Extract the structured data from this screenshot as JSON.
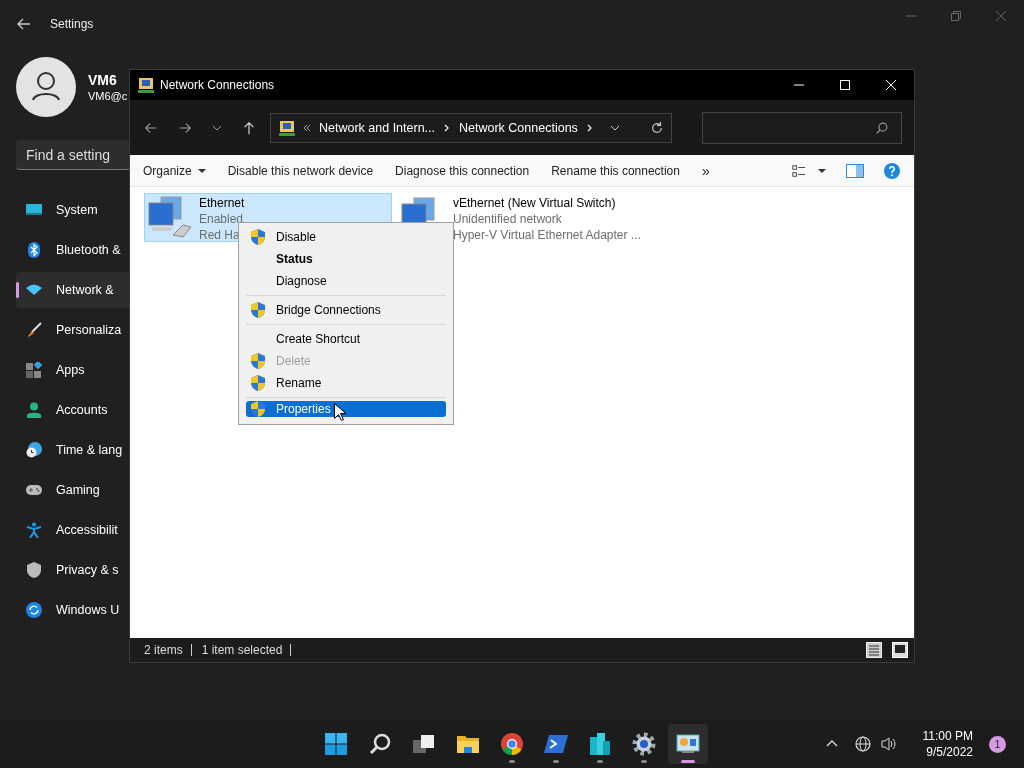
{
  "settings": {
    "title": "Settings",
    "user": {
      "name": "VM6",
      "email": "VM6@c"
    },
    "search": {
      "placeholder": "Find a setting"
    },
    "nav": [
      {
        "kind": "system",
        "label": "System",
        "selected": false
      },
      {
        "kind": "bluetooth",
        "label": "Bluetooth &",
        "selected": false
      },
      {
        "kind": "network",
        "label": "Network &",
        "selected": true
      },
      {
        "kind": "personalize",
        "label": "Personaliza",
        "selected": false
      },
      {
        "kind": "apps",
        "label": "Apps",
        "selected": false
      },
      {
        "kind": "accounts",
        "label": "Accounts",
        "selected": false
      },
      {
        "kind": "time",
        "label": "Time & lang",
        "selected": false
      },
      {
        "kind": "gaming",
        "label": "Gaming",
        "selected": false
      },
      {
        "kind": "accessibility",
        "label": "Accessibilit",
        "selected": false
      },
      {
        "kind": "privacy",
        "label": "Privacy & s",
        "selected": false
      },
      {
        "kind": "update",
        "label": "Windows U",
        "selected": false
      }
    ]
  },
  "explorer": {
    "title": "Network Connections",
    "breadcrumb": [
      "Network and Intern...",
      "Network Connections"
    ],
    "commands": [
      {
        "label": "Organize",
        "dropdown": true
      },
      {
        "label": "Disable this network device",
        "dropdown": false
      },
      {
        "label": "Diagnose this connection",
        "dropdown": false
      },
      {
        "label": "Rename this connection",
        "dropdown": false
      }
    ],
    "more": "»",
    "items": [
      {
        "name": "Ethernet",
        "status": "Enabled",
        "device": "Red Ha",
        "selected": true
      },
      {
        "name": "vEthernet (New Virtual Switch)",
        "status": "Unidentified network",
        "device": "Hyper-V Virtual Ethernet Adapter ...",
        "selected": false
      }
    ],
    "context_menu": [
      [
        {
          "label": "Disable",
          "shield": true,
          "bold": false,
          "disabled": false,
          "selected": false
        },
        {
          "label": "Status",
          "shield": false,
          "bold": true,
          "disabled": false,
          "selected": false
        },
        {
          "label": "Diagnose",
          "shield": false,
          "bold": false,
          "disabled": false,
          "selected": false
        }
      ],
      [
        {
          "label": "Bridge Connections",
          "shield": true,
          "bold": false,
          "disabled": false,
          "selected": false
        }
      ],
      [
        {
          "label": "Create Shortcut",
          "shield": false,
          "bold": false,
          "disabled": false,
          "selected": false
        },
        {
          "label": "Delete",
          "shield": true,
          "bold": false,
          "disabled": true,
          "selected": false
        },
        {
          "label": "Rename",
          "shield": true,
          "bold": false,
          "disabled": false,
          "selected": false
        }
      ],
      [
        {
          "label": "Properties",
          "shield": true,
          "bold": false,
          "disabled": false,
          "selected": true
        }
      ]
    ],
    "status_bar": [
      "2 items",
      "1 item selected"
    ]
  },
  "taskbar": {
    "apps": [
      {
        "kind": "start",
        "running": false,
        "active": false
      },
      {
        "kind": "search",
        "running": false,
        "active": false
      },
      {
        "kind": "taskview",
        "running": false,
        "active": false
      },
      {
        "kind": "files",
        "running": false,
        "active": false
      },
      {
        "kind": "browser",
        "running": true,
        "active": false
      },
      {
        "kind": "terminal",
        "running": true,
        "active": false
      },
      {
        "kind": "buildings",
        "running": true,
        "active": false
      },
      {
        "kind": "settings",
        "running": true,
        "active": false
      },
      {
        "kind": "network",
        "running": true,
        "active": true
      }
    ],
    "clock": {
      "time": "11:00 PM",
      "date": "9/5/2022"
    },
    "notifications": "1"
  }
}
